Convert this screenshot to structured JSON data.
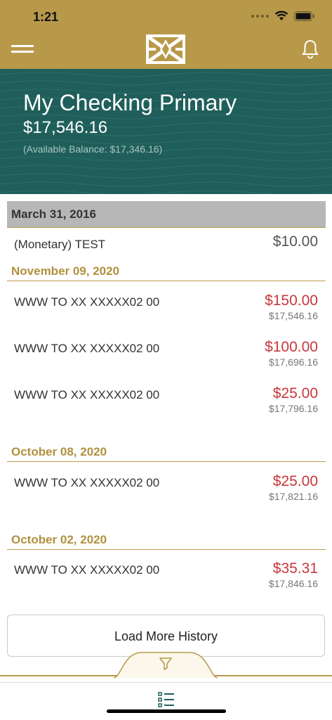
{
  "status_bar": {
    "time": "1:21"
  },
  "account": {
    "name": "My Checking Primary",
    "balance": "$17,546.16",
    "available_balance": "(Available Balance: $17,346.16)"
  },
  "pending": {
    "date": "March 31, 2016",
    "transaction": {
      "description": "(Monetary) TEST",
      "amount": "$10.00"
    }
  },
  "groups": [
    {
      "date": "November 09, 2020",
      "transactions": [
        {
          "description": "WWW TO XX XXXXX02 00",
          "amount": "$150.00",
          "running_balance": "$17,546.16"
        },
        {
          "description": "WWW TO XX XXXXX02 00",
          "amount": "$100.00",
          "running_balance": "$17,696.16"
        },
        {
          "description": "WWW TO XX XXXXX02 00",
          "amount": "$25.00",
          "running_balance": "$17,796.16"
        }
      ]
    },
    {
      "date": "October 08, 2020",
      "transactions": [
        {
          "description": "WWW TO XX XXXXX02 00",
          "amount": "$25.00",
          "running_balance": "$17,821.16"
        }
      ]
    },
    {
      "date": "October 02, 2020",
      "transactions": [
        {
          "description": "WWW TO XX XXXXX02 00",
          "amount": "$35.31",
          "running_balance": "$17,846.16"
        }
      ]
    }
  ],
  "load_more_label": "Load More History",
  "colors": {
    "header_gold": "#b8994a",
    "hero_teal": "#1f5e5a",
    "debit_red": "#c8373c",
    "date_gold": "#b0913e"
  },
  "icons": {
    "menu": "hamburger-menu-icon",
    "logo": "bank-logo",
    "notifications": "bell-icon",
    "filter": "filter-icon",
    "list": "list-icon"
  }
}
